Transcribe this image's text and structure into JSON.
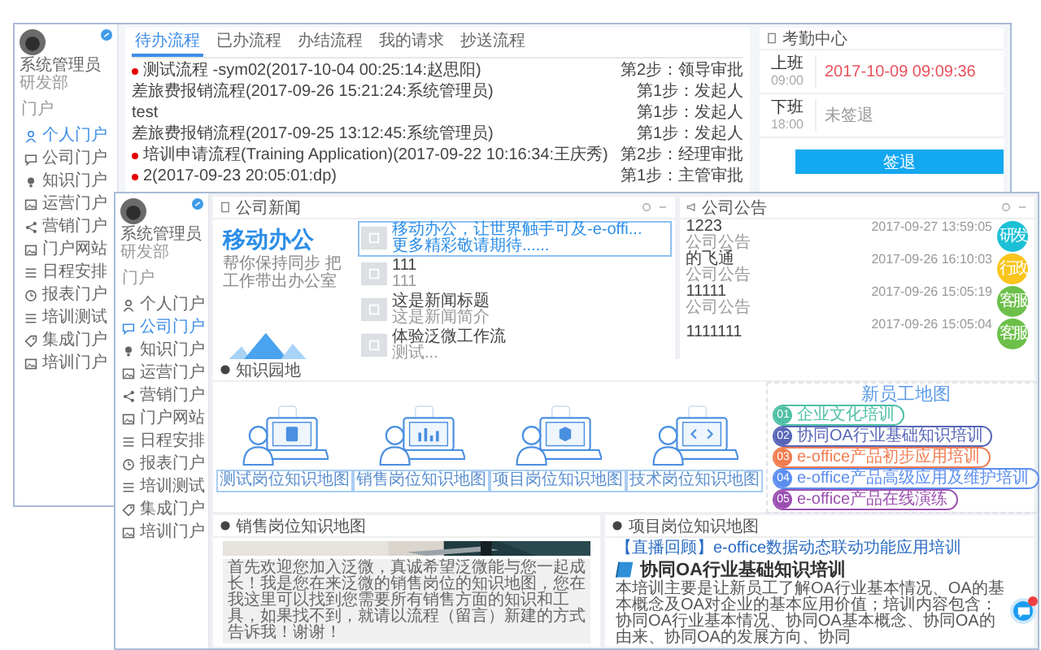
{
  "back_window": {
    "user": {
      "name": "系统管理员",
      "dept": "研发部"
    },
    "sidebar": {
      "heading": "门户",
      "items": [
        {
          "label": "个人门户",
          "kind": "person",
          "selected": true
        },
        {
          "label": "公司门户",
          "kind": "chat",
          "selected": false
        },
        {
          "label": "知识门户",
          "kind": "bulb",
          "selected": false
        },
        {
          "label": "运营门户",
          "kind": "picture",
          "selected": false
        },
        {
          "label": "营销门户",
          "kind": "share",
          "selected": false
        },
        {
          "label": "门户网站",
          "kind": "picture",
          "selected": false
        },
        {
          "label": "日程安排",
          "kind": "list",
          "selected": false
        },
        {
          "label": "报表门户",
          "kind": "clock",
          "selected": false
        },
        {
          "label": "培训测试",
          "kind": "list",
          "selected": false
        },
        {
          "label": "集成门户",
          "kind": "tag",
          "selected": false
        },
        {
          "label": "培训门户",
          "kind": "picture",
          "selected": false
        }
      ]
    },
    "flow_tabs": [
      {
        "label": "待办流程",
        "selected": true
      },
      {
        "label": "已办流程",
        "selected": false
      },
      {
        "label": "办结流程",
        "selected": false
      },
      {
        "label": "我的请求",
        "selected": false
      },
      {
        "label": "抄送流程",
        "selected": false
      }
    ],
    "flow_rows": [
      {
        "title": "测试流程 -sym02(2017-10-04 00:25:14:赵思阳)",
        "urgent": true,
        "step": "第2步：领导审批"
      },
      {
        "title": "差旅费报销流程(2017-09-26 15:21:24:系统管理员)",
        "urgent": false,
        "step": "第1步：发起人"
      },
      {
        "title": "test",
        "urgent": false,
        "step": "第1步：发起人"
      },
      {
        "title": "差旅费报销流程(2017-09-25 13:12:45:系统管理员)",
        "urgent": false,
        "step": "第1步：发起人"
      },
      {
        "title": "培训申请流程(Training Application)(2017-09-22 10:16:34:王庆秀)",
        "urgent": true,
        "step": "第2步：经理审批"
      },
      {
        "title": "2(2017-09-23 20:05:01:dp)",
        "urgent": true,
        "step": "第1步：主管审批"
      }
    ],
    "attendance": {
      "title": "考勤中心",
      "records": [
        {
          "label": "上班",
          "time": "09:00",
          "value": "2017-10-09 09:09:36",
          "signed": true
        },
        {
          "label": "下班",
          "time": "18:00",
          "value": "未签退",
          "signed": false
        }
      ],
      "button": "签退"
    }
  },
  "front_window": {
    "user": {
      "name": "系统管理员",
      "dept": "研发部"
    },
    "sidebar": {
      "heading": "门户",
      "items": [
        {
          "label": "个人门户",
          "kind": "person",
          "selected": false
        },
        {
          "label": "公司门户",
          "kind": "chat",
          "selected": true
        },
        {
          "label": "知识门户",
          "kind": "bulb",
          "selected": false
        },
        {
          "label": "运营门户",
          "kind": "picture",
          "selected": false
        },
        {
          "label": "营销门户",
          "kind": "share",
          "selected": false
        },
        {
          "label": "门户网站",
          "kind": "picture",
          "selected": false
        },
        {
          "label": "日程安排",
          "kind": "list",
          "selected": false
        },
        {
          "label": "报表门户",
          "kind": "clock",
          "selected": false
        },
        {
          "label": "培训测试",
          "kind": "list",
          "selected": false
        },
        {
          "label": "集成门户",
          "kind": "tag",
          "selected": false
        },
        {
          "label": "培训门户",
          "kind": "picture",
          "selected": false
        }
      ]
    },
    "news": {
      "title": "公司新闻",
      "banner": {
        "title": "移动办公",
        "subtitle": "帮你保持同步 把工作带出办公室"
      },
      "items": [
        {
          "title": "移动办公，让世界触手可及-e-offi...",
          "summary": "更多精彩敬请期待......",
          "selected": true
        },
        {
          "title": "111",
          "summary": "111",
          "selected": false
        },
        {
          "title": "这是新闻标题",
          "summary": "这是新闻简介",
          "selected": false
        },
        {
          "title": "体验泛微工作流",
          "summary": "测试...",
          "selected": false
        }
      ]
    },
    "notices": {
      "title": "公司公告",
      "items": [
        {
          "title": "1223",
          "category": "公司公告",
          "time": "2017-09-27 13:59:05",
          "badge": "研发",
          "color": "#1cc0d6"
        },
        {
          "title": "的飞通",
          "category": "公司公告",
          "time": "2017-09-26 16:10:03",
          "badge": "行政",
          "color": "#f9c51d"
        },
        {
          "title": "11111",
          "category": "公司公告",
          "time": "2017-09-26 15:05:19",
          "badge": "客服",
          "color": "#6cc04a"
        },
        {
          "title": "1111111",
          "time": "2017-09-26 15:05:04",
          "badge": "客服",
          "color": "#6cc04a"
        }
      ]
    },
    "knowledge": {
      "title": "知识园地",
      "cards": [
        {
          "label": "测试岗位知识地图",
          "kind": "html"
        },
        {
          "label": "销售岗位知识地图",
          "kind": "chart"
        },
        {
          "label": "项目岗位知识地图",
          "kind": "database"
        },
        {
          "label": "技术岗位知识地图",
          "kind": "code"
        }
      ],
      "map": {
        "title": "新员工地图",
        "steps": [
          {
            "number": "01",
            "label": "企业文化培训",
            "color": "#4fbfa5"
          },
          {
            "number": "02",
            "label": "协同OA行业基础知识培训",
            "color": "#5865b8"
          },
          {
            "number": "03",
            "label": "e-office产品初步应用培训",
            "color": "#f07c50"
          },
          {
            "number": "04",
            "label": "e-office产品高级应用及维护培训",
            "color": "#5b8def"
          },
          {
            "number": "05",
            "label": "e-office产品在线演练",
            "color": "#9b4fb0"
          }
        ]
      }
    },
    "sales": {
      "title": "销售岗位知识地图",
      "text": "首先欢迎您加入泛微，真诚希望泛微能与您一起成长！我是您在来泛微的销售岗位的知识地图，您在我这里可以找到您需要所有销售方面的知识和工具，如果找不到，就请以流程（留言）新建的方式告诉我！谢谢！"
    },
    "project": {
      "title": "项目岗位知识地图",
      "link": "【直播回顾】e-office数据动态联动功能应用培训",
      "heading": "协同OA行业基础知识培训",
      "text": "本培训主要是让新员工了解OA行业基本情况、OA的基本概念及OA对企业的基本应用价值；培训内容包含：协同OA行业基本情况、协同OA基本概念、协同OA的由来、协同OA的发展方向、协同"
    }
  }
}
